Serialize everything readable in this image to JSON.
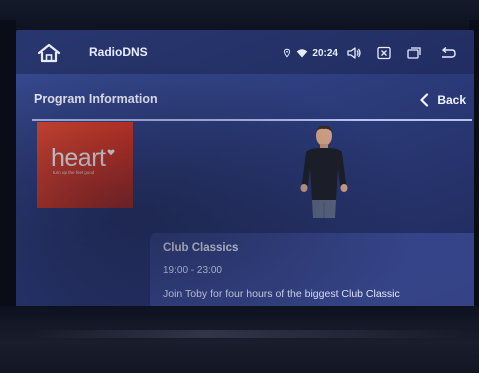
{
  "status_bar": {
    "app_title": "RadioDNS",
    "clock": "20:24",
    "icons": [
      "home-icon",
      "location-icon",
      "wifi-icon",
      "volume-icon",
      "close-box-icon",
      "windows-icon",
      "return-icon"
    ]
  },
  "header": {
    "title": "Program Information",
    "back_label": "Back"
  },
  "station": {
    "logo_text": "heart",
    "logo_tagline": "turn up the feel good",
    "brand_color": "#da3a22"
  },
  "program": {
    "title": "Club Classics",
    "time": "19:00 - 23:00",
    "description": "Join Toby for four hours of the biggest Club Classic"
  },
  "colors": {
    "screen_bg": "#2c3c7c",
    "divider": "#b8c2ee",
    "text": "#f2f4ff"
  }
}
